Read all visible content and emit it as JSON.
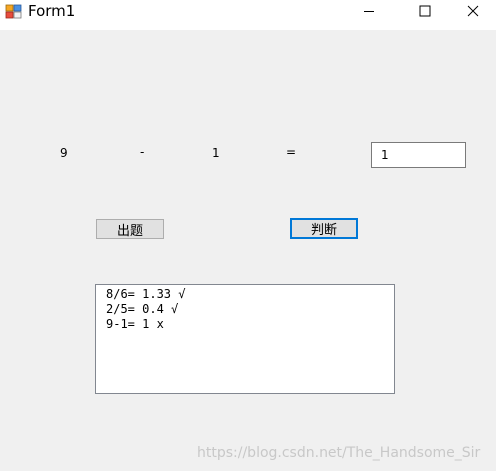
{
  "window": {
    "title": "Form1",
    "icon": "winforms-app-icon",
    "controls": {
      "minimize_icon": "minimize-icon",
      "maximize_icon": "maximize-icon",
      "close_icon": "close-icon"
    }
  },
  "equation": {
    "operand1": "9",
    "operator": "-",
    "operand2": "1",
    "equals": "=",
    "answer_value": "1"
  },
  "buttons": {
    "question_label": "出题",
    "judge_label": "判断"
  },
  "results": [
    "8/6= 1.33 √",
    "2/5= 0.4 √",
    "9-1= 1 x"
  ],
  "watermark": "https://blog.csdn.net/The_Handsome_Sir",
  "colors": {
    "window_bg": "#f0f0f0",
    "titlebar_bg": "#ffffff",
    "focus_border": "#0078d7",
    "button_bg": "#e1e1e1"
  }
}
